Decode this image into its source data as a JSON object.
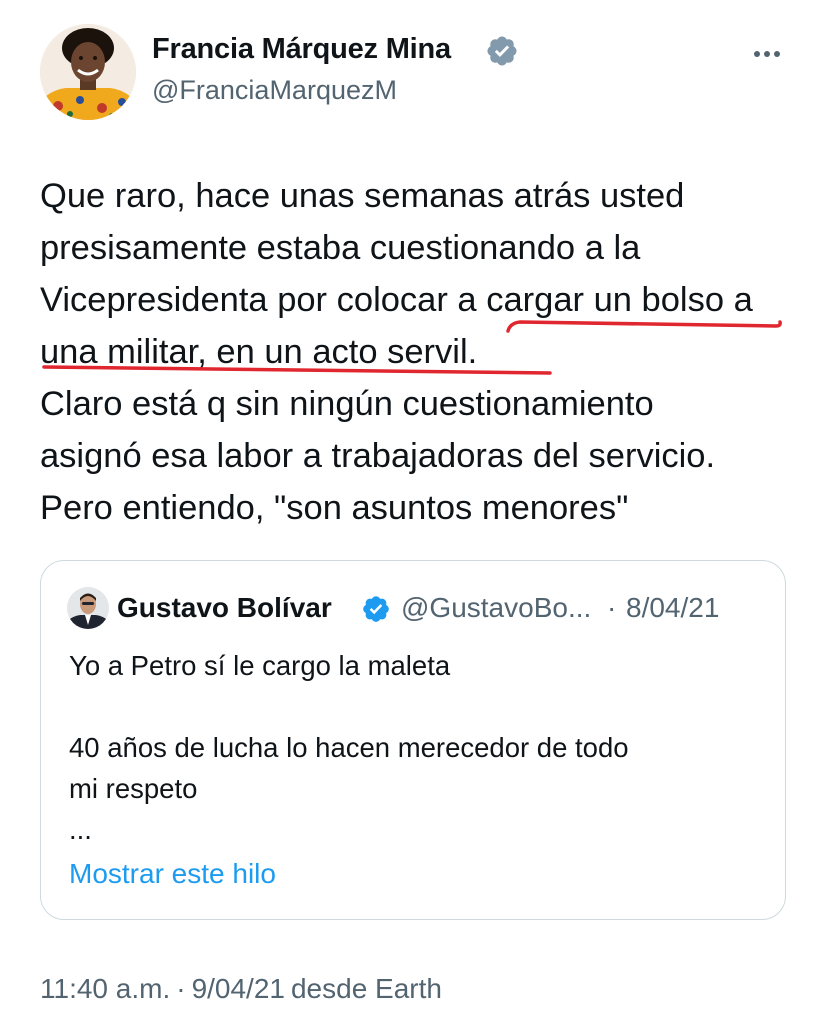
{
  "author": {
    "name": "Francia Márquez Mina",
    "handle": "@FranciaMarquezM",
    "verified": true
  },
  "tweet": {
    "lines": [
      "Que raro, hace unas semanas atrás usted",
      "presisamente estaba cuestionando a la",
      "Vicepresidenta por colocar a cargar un bolso a",
      "una militar, en un acto servil.",
      "Claro está q sin ningún cuestionamiento",
      "asignó esa labor a trabajadoras del servicio.",
      "Pero entiendo, \"son asuntos menores\""
    ]
  },
  "quote": {
    "name": "Gustavo Bolívar",
    "handle": "@GustavoBo...",
    "separator": "·",
    "date": "8/04/21",
    "verified": true,
    "body": [
      "Yo a Petro sí le cargo la maleta",
      "",
      "40 años de lucha lo hacen merecedor de todo",
      "mi respeto",
      "..."
    ],
    "show_thread_label": "Mostrar este hilo"
  },
  "meta": {
    "time": "11:40 a.m.",
    "separator": "·",
    "date": "9/04/21",
    "source": "desde Earth"
  },
  "colors": {
    "text": "#0f1419",
    "secondary": "#536471",
    "link": "#1d9bf0",
    "verified_badge": "#829aab",
    "annotation": "#e0262e",
    "border": "#cfd9de"
  },
  "icons": {
    "verified": "verified-badge-icon",
    "more": "more-options-icon"
  }
}
